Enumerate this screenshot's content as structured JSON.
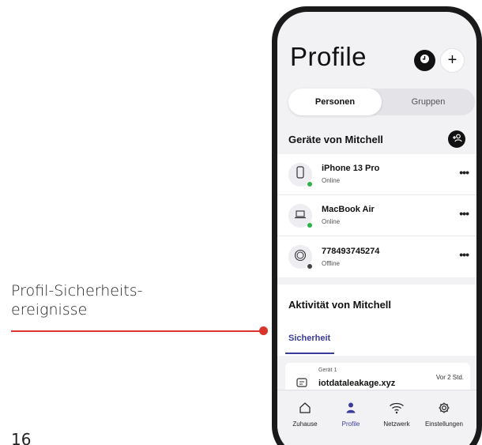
{
  "annotation": {
    "label": "Profil-Sicherheits-\nereignisse",
    "line_color": "#d9342b"
  },
  "page_number": "16",
  "app": {
    "title": "Profile",
    "header_icons": [
      "clock-icon",
      "plus-icon"
    ],
    "add_label": "+",
    "segments": [
      {
        "label": "Personen",
        "active": true
      },
      {
        "label": "Gruppen",
        "active": false
      }
    ],
    "devices_section": {
      "title": "Geräte von Mitchell",
      "devices": [
        {
          "name": "iPhone 13 Pro",
          "status": "Online",
          "icon": "phone-icon",
          "status_color": "#2bb34a"
        },
        {
          "name": "MacBook Air",
          "status": "Online",
          "icon": "laptop-icon",
          "status_color": "#2bb34a"
        },
        {
          "name": "778493745274",
          "status": "Offline",
          "icon": "device-icon",
          "status_color": "#444444"
        }
      ],
      "more_label": "•••"
    },
    "activity_section": {
      "title": "Aktivität von Mitchell",
      "tab_label": "Sicherheit",
      "accent": "#3b3b9a"
    },
    "event": {
      "subtitle": "Gerät 1",
      "name": "iotdataleakage.xyz",
      "time": "Vor 2 Std."
    },
    "tabbar": [
      {
        "label": "Zuhause",
        "icon": "home-icon",
        "active": false
      },
      {
        "label": "Profile",
        "icon": "person-icon",
        "active": true
      },
      {
        "label": "Netzwerk",
        "icon": "wifi-icon",
        "active": false
      },
      {
        "label": "Einstellungen",
        "icon": "gear-icon",
        "active": false
      }
    ]
  }
}
